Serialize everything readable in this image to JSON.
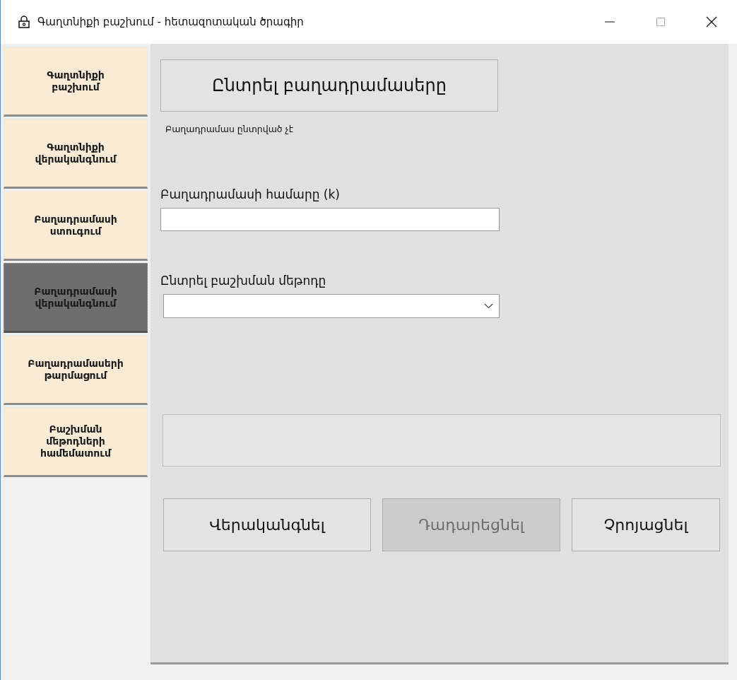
{
  "window": {
    "title": "Գաղտնիքի բաշխում - հետազոտական ծրագիր"
  },
  "sidebar": {
    "items": [
      {
        "label": "Գաղտնիքի բաշխում",
        "selected": false
      },
      {
        "label": "Գաղտնիքի վերականգնում",
        "selected": false
      },
      {
        "label": "Բաղադրամասի ստուգում",
        "selected": false
      },
      {
        "label": "Բաղադրամասի վերականգնում",
        "selected": true
      },
      {
        "label": "Բաղադրամասերի թարմացում",
        "selected": false
      },
      {
        "label": "Բաշխման մեթոդների համեմատում",
        "selected": false
      }
    ]
  },
  "main": {
    "select_button": "Ընտրել բաղադրամասերը",
    "status": "Բաղադրամաս ընտրված չէ",
    "k_field": {
      "label": "Բաղադրամասի համարը (k)"
    },
    "method_select": {
      "label": "Ընտրել բաշխման մեթոդը"
    },
    "buttons": [
      {
        "label": "Վերականգնել",
        "disabled": false
      },
      {
        "label": "Դադարեցնել",
        "disabled": true
      },
      {
        "label": "Չրոյացնել",
        "disabled": false
      }
    ]
  }
}
